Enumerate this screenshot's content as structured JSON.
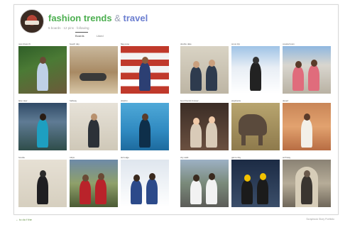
{
  "profile": {
    "title_part1": "fashion trends",
    "title_amp": "&",
    "title_part2": "travel",
    "meta": "5 boards · 12 pins · following"
  },
  "tabs": [
    {
      "label": "Boards",
      "active": true
    },
    {
      "label": "Liked"
    }
  ],
  "photos": [
    {
      "caption": "new dress fit",
      "scene": "garden"
    },
    {
      "caption": "beach day",
      "scene": "beach"
    },
    {
      "caption": "flag pose",
      "scene": "flag"
    },
    {
      "caption": "double date",
      "scene": "indoor-duo"
    },
    {
      "caption": "snow trip",
      "scene": "snow-ski"
    },
    {
      "caption": "coastal town",
      "scene": "coast"
    },
    {
      "caption": "lake view",
      "scene": "lake"
    },
    {
      "caption": "hallway",
      "scene": "hall"
    },
    {
      "caption": "dolphin",
      "scene": "pool"
    },
    {
      "caption": "best friends forever",
      "scene": "friends"
    },
    {
      "caption": "elephants",
      "scene": "elephant"
    },
    {
      "caption": "desert",
      "scene": "desert"
    },
    {
      "caption": "hoodie",
      "scene": "wall"
    },
    {
      "caption": "tulips",
      "scene": "outdoor-red"
    },
    {
      "caption": "ski lodge",
      "scene": "snow-duo"
    },
    {
      "caption": "city walk",
      "scene": "city"
    },
    {
      "caption": "game day",
      "scene": "stadium"
    },
    {
      "caption": "archway",
      "scene": "arch"
    }
  ],
  "footer": {
    "left": "← to do f the",
    "right": "Scrapbook Story Portfolio"
  },
  "colors": {
    "accent_green": "#4caf50",
    "accent_blue": "#6b7ed0"
  }
}
